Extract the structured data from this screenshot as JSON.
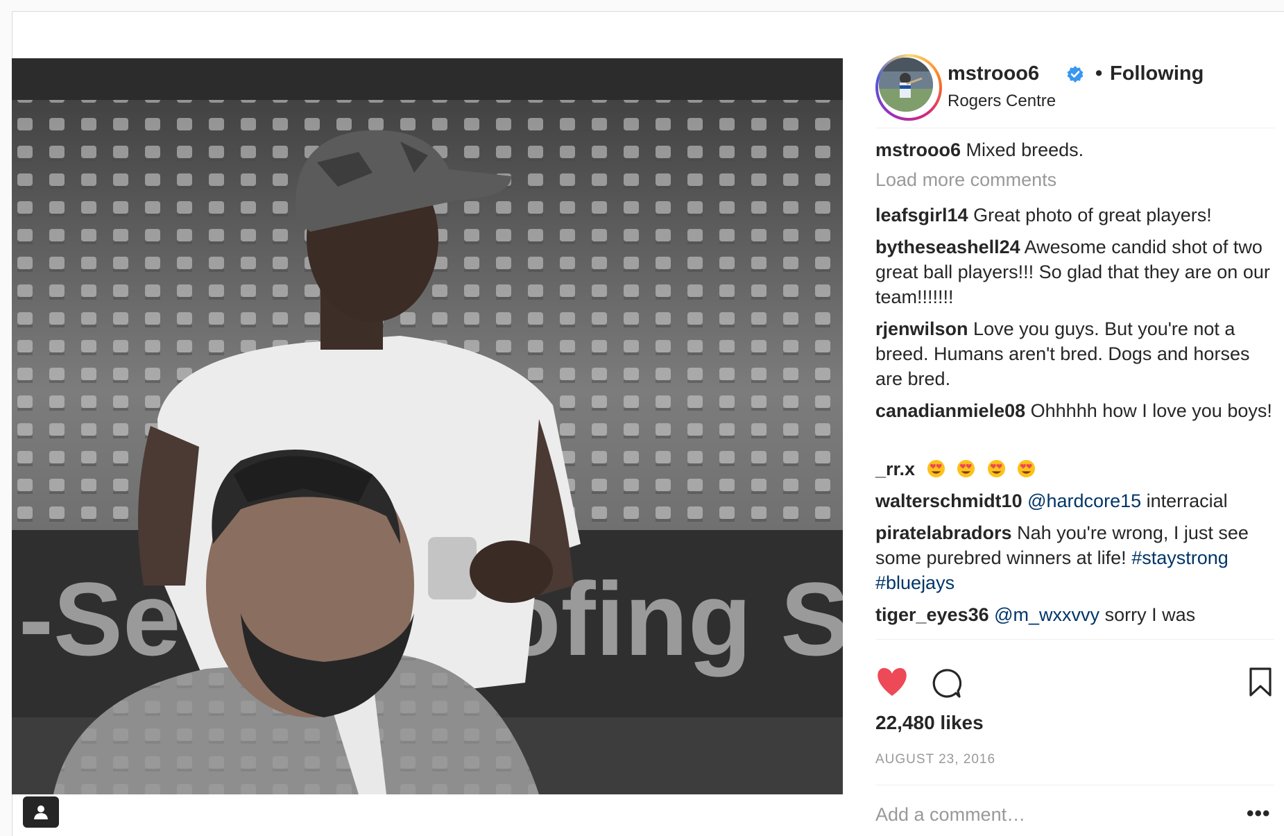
{
  "post": {
    "username": "mstrooo6",
    "follow_status": "Following",
    "dot": "•",
    "location": "Rogers Centre",
    "caption": "Mixed breeds.",
    "load_more": "Load more comments",
    "likes": "22,480 likes",
    "date": "AUGUST 23, 2016",
    "add_comment_placeholder": "Add a comment…",
    "more_glyph": "•••"
  },
  "photo": {
    "banner_text_1": "-Se",
    "banner_text_2": "ofing S"
  },
  "comments": [
    {
      "user": "leafsgirl14",
      "text": "Great photo of great players!"
    },
    {
      "user": "bytheseashell24",
      "text": "Awesome candid shot of two great ball players!!! So glad that they are on our team!!!!!!!"
    },
    {
      "user": "rjenwilson",
      "text": "Love you guys. But you're not a breed. Humans aren't bred. Dogs and horses are bred."
    },
    {
      "user": "canadianmiele08",
      "text": "Ohhhhh how I love you boys!"
    },
    {
      "user": "_rr.x",
      "text": ""
    },
    {
      "user": "walterschmidt10",
      "mention": "@hardcore15",
      "text": "interracial"
    },
    {
      "user": "piratelabradors",
      "text": "Nah you're wrong, I just see some purebred winners at life!",
      "hashtag_1": "#staystrong",
      "hashtag_2": "#bluejays"
    },
    {
      "user": "tiger_eyes36",
      "mention": "@m_wxxvvy",
      "text": "sorry I was"
    }
  ],
  "icons": {
    "like": "heart-icon",
    "comment": "comment-bubble-icon",
    "save": "bookmark-icon",
    "verified": "verified-badge-icon",
    "tag": "user-tag-icon",
    "emoji": "heart-eyes-emoji"
  },
  "colors": {
    "like_red": "#ed4956",
    "link_blue": "#003569",
    "verified_blue": "#3897f0",
    "muted_gray": "#999999"
  }
}
